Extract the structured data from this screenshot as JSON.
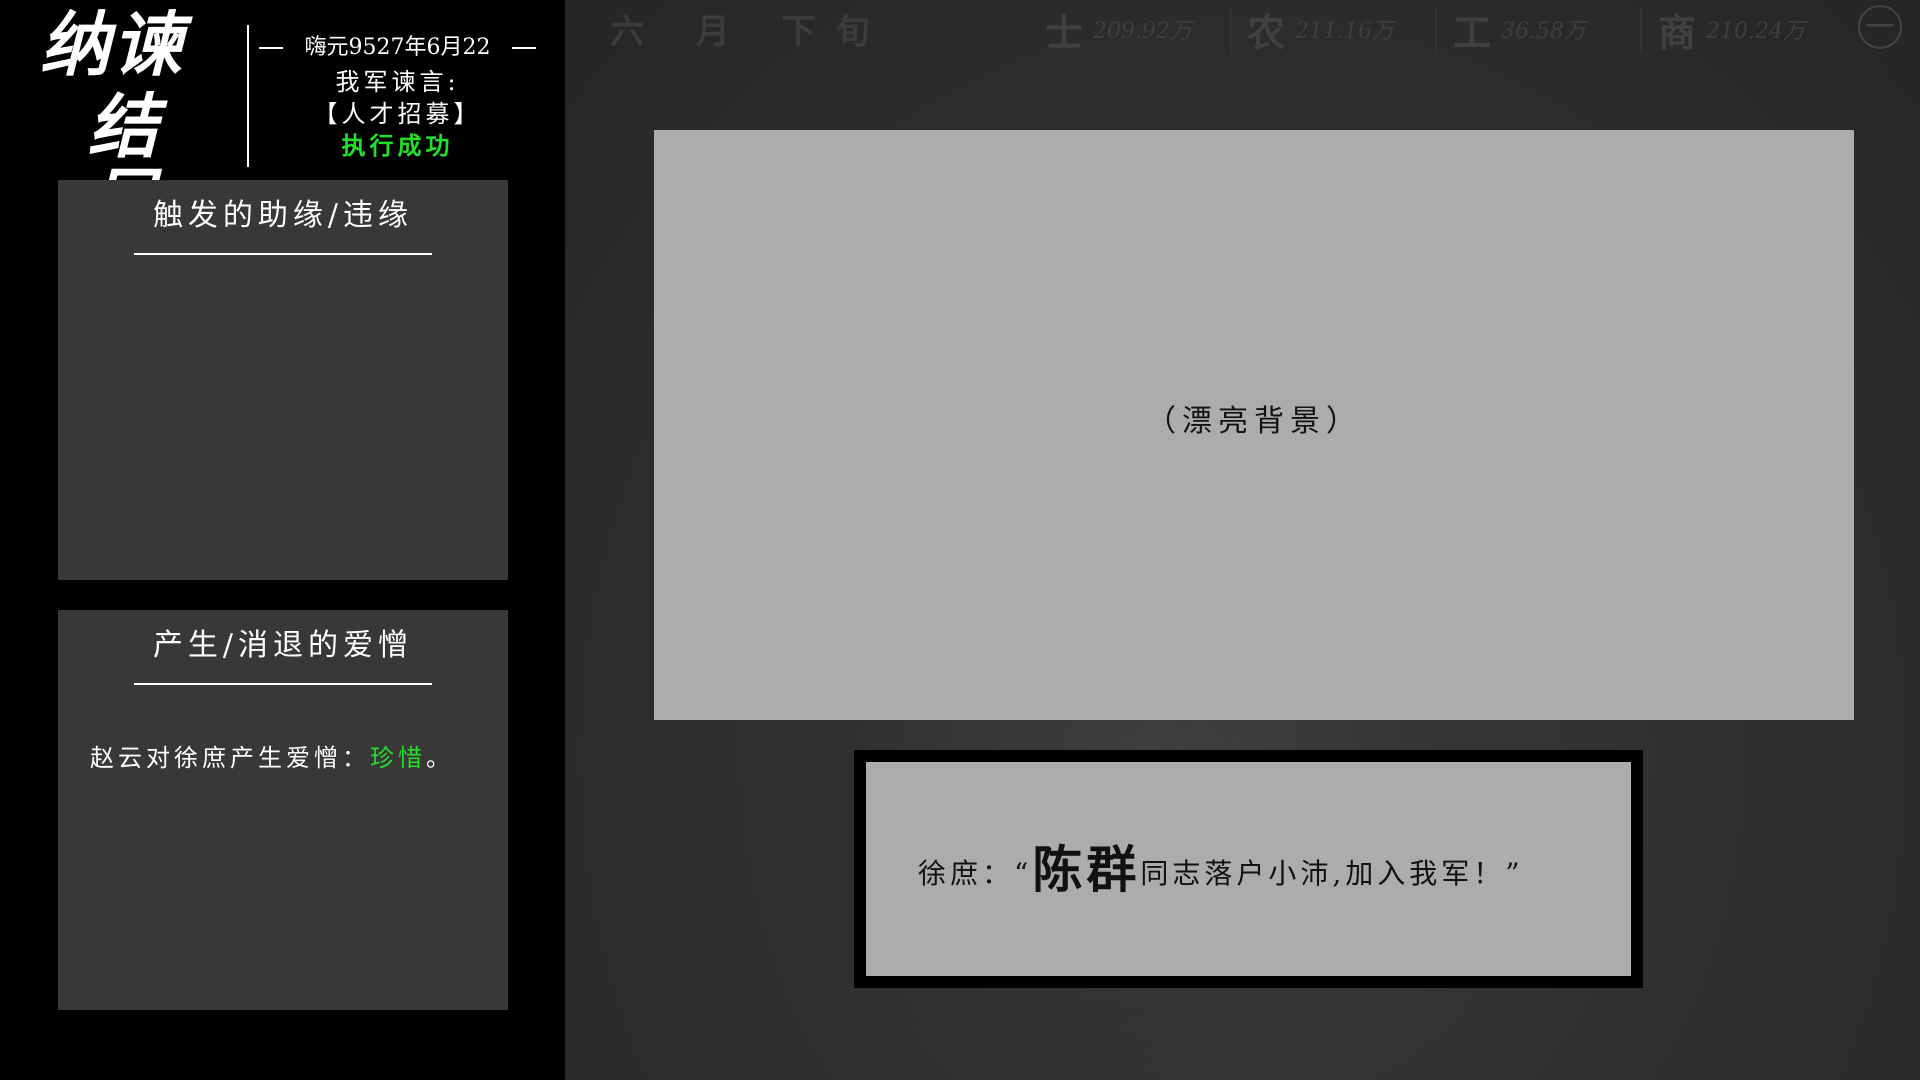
{
  "header": {
    "ending_title_line1": "纳谏",
    "ending_title_line2": "结局",
    "date": "嗨元9527年6月22",
    "advice_label": "我军谏言:",
    "advice_name": "【人才招募】",
    "advice_result": "执行成功"
  },
  "cards": {
    "relations": {
      "title": "触发的助缘/违缘",
      "body": ""
    },
    "emotions": {
      "title": "产生/消退的爱憎",
      "text_prefix": "赵云对徐庶产生爱憎：",
      "text_accent": "珍惜",
      "text_suffix": "。"
    }
  },
  "top_bar": {
    "period": "六 月 下旬",
    "stats": [
      {
        "icon": "士",
        "value": "209.92万"
      },
      {
        "icon": "农",
        "value": "211.16万"
      },
      {
        "icon": "工",
        "value": "36.58万"
      },
      {
        "icon": "商",
        "value": "210.24万"
      }
    ],
    "menu_glyph": "一"
  },
  "scene": {
    "label": "（漂亮背景）"
  },
  "dialog": {
    "speaker": "徐庶：",
    "open_quote": "“",
    "emphasis": "陈群",
    "rest": "同志落户小沛,加入我军！",
    "close_quote": "”"
  },
  "colors": {
    "accent_green": "#22e02a",
    "panel_bg": "#383838",
    "scene_bg": "#acacac"
  }
}
